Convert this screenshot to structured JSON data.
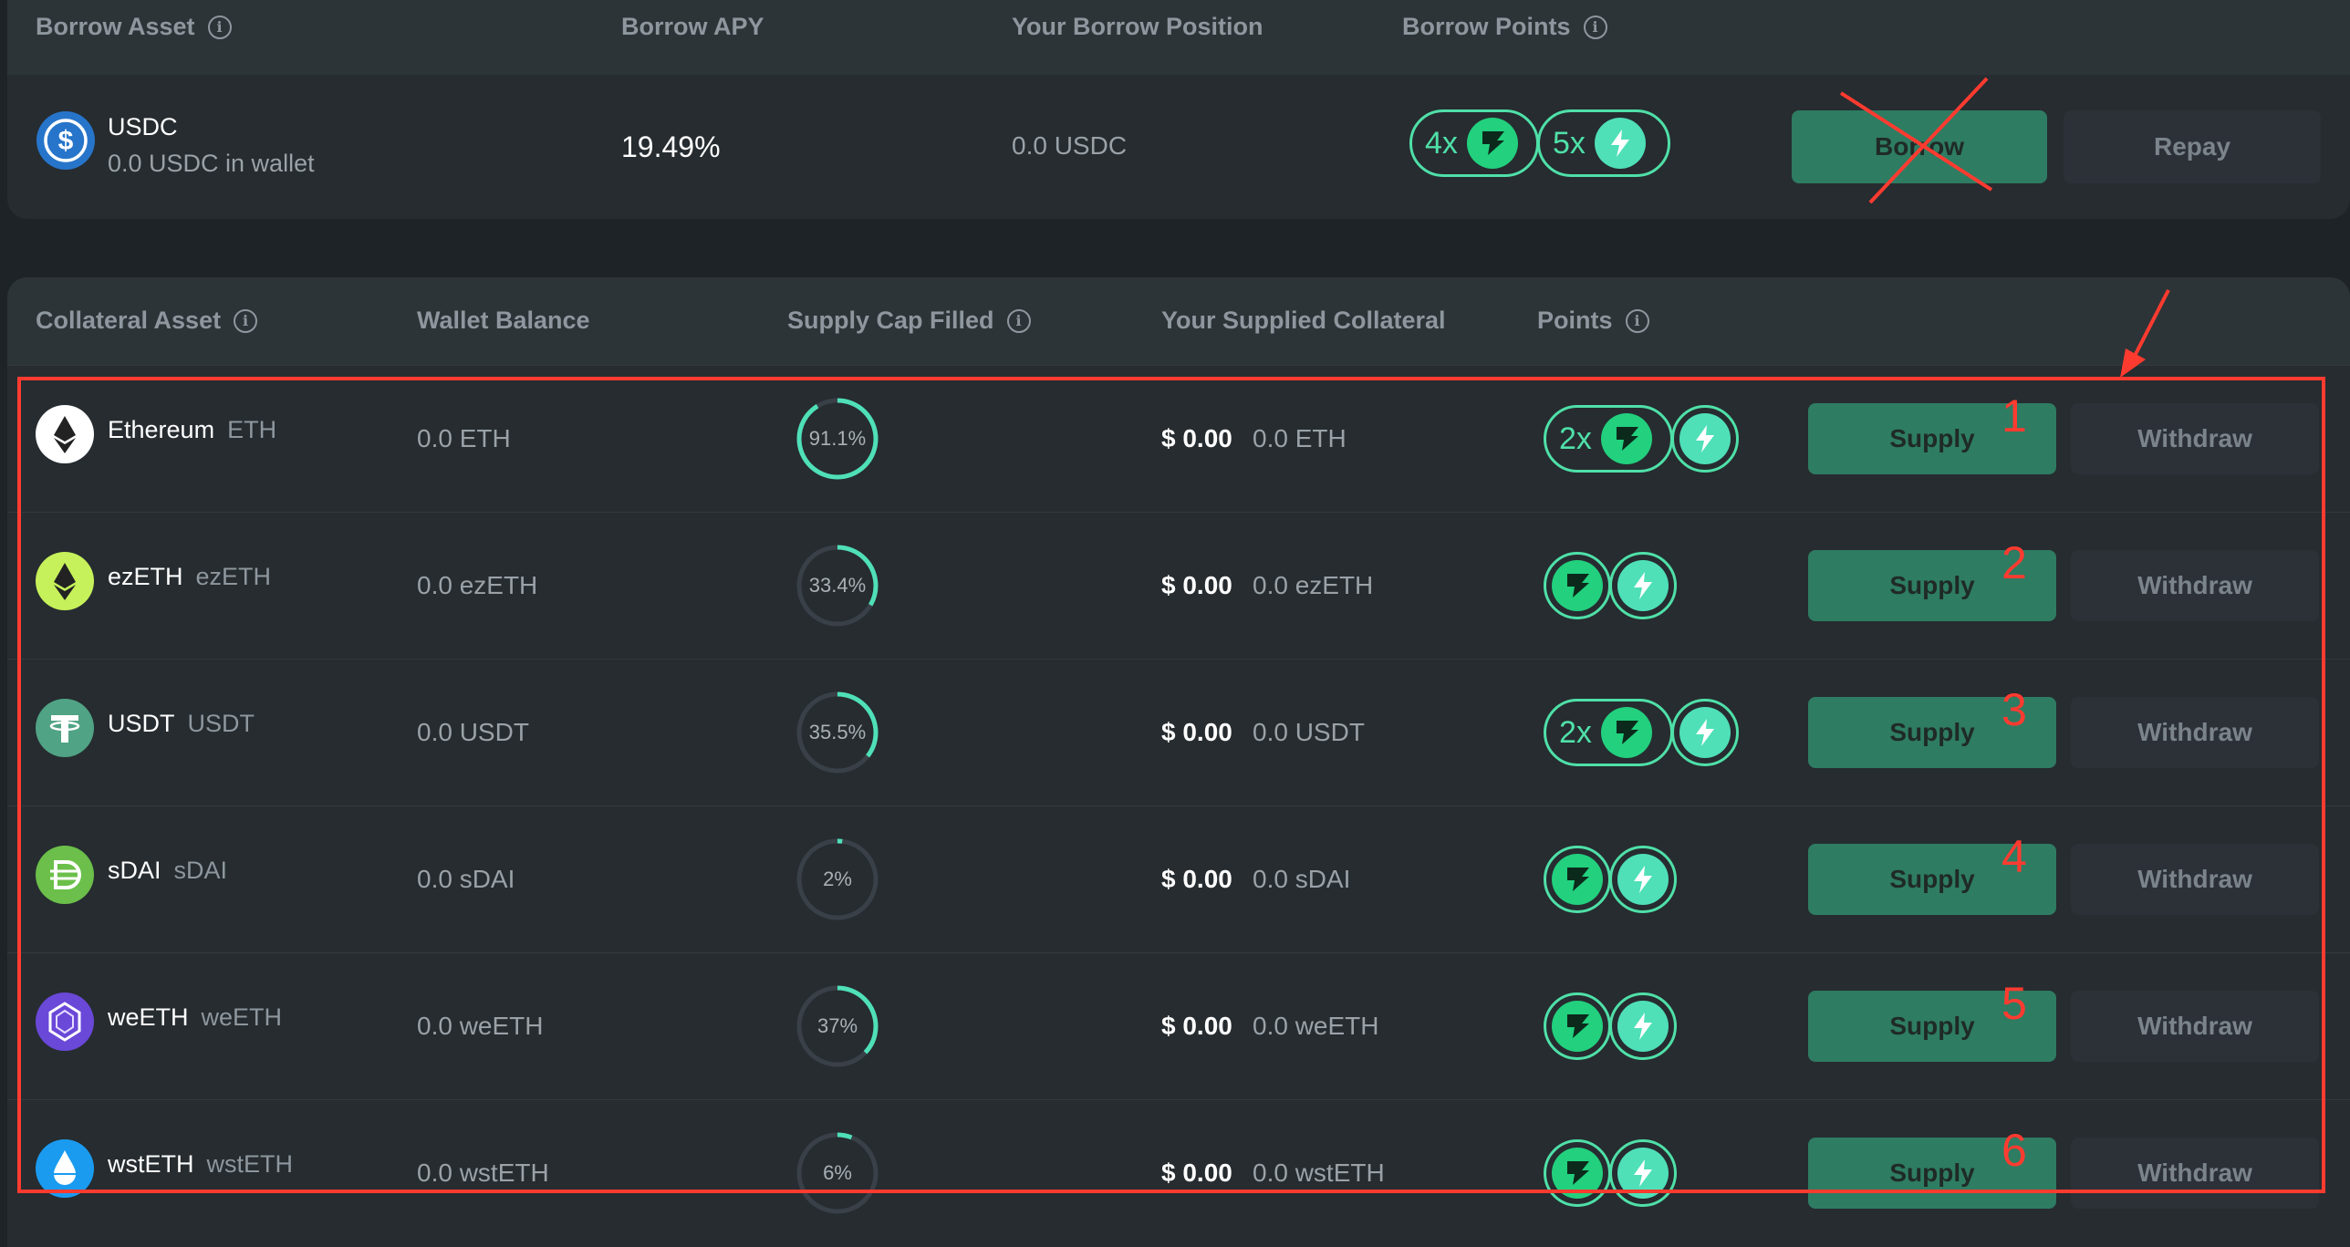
{
  "colors": {
    "accent": "#4fe0a8",
    "supply_button": "#2e7c62",
    "annotation_red": "#ff3b30"
  },
  "borrow": {
    "headers": [
      "Borrow Asset",
      "Borrow APY",
      "Your Borrow Position",
      "Borrow Points"
    ],
    "asset_name": "USDC",
    "wallet_text": "0.0 USDC in wallet",
    "apy": "19.49%",
    "position": "0.0 USDC",
    "points": [
      {
        "multiplier": "4x",
        "icon": "flag-icon"
      },
      {
        "multiplier": "5x",
        "icon": "lightning-icon"
      }
    ],
    "borrow_label": "Borrow",
    "repay_label": "Repay"
  },
  "collateral": {
    "headers": [
      "Collateral Asset",
      "Wallet Balance",
      "Supply Cap Filled",
      "Your Supplied Collateral",
      "Points"
    ],
    "rows": [
      {
        "name": "Ethereum",
        "symbol": "ETH",
        "balance": "0.0 ETH",
        "cap_label": "91.1%",
        "cap": 0.911,
        "usd": "$ 0.00",
        "amount": "0.0 ETH",
        "flag_mult": "2x",
        "supply": "Supply",
        "withdraw": "Withdraw",
        "annotation": "1"
      },
      {
        "name": "ezETH",
        "symbol": "ezETH",
        "balance": "0.0 ezETH",
        "cap_label": "33.4%",
        "cap": 0.334,
        "usd": "$ 0.00",
        "amount": "0.0 ezETH",
        "flag_mult": "",
        "supply": "Supply",
        "withdraw": "Withdraw",
        "annotation": "2"
      },
      {
        "name": "USDT",
        "symbol": "USDT",
        "balance": "0.0 USDT",
        "cap_label": "35.5%",
        "cap": 0.355,
        "usd": "$ 0.00",
        "amount": "0.0 USDT",
        "flag_mult": "2x",
        "supply": "Supply",
        "withdraw": "Withdraw",
        "annotation": "3"
      },
      {
        "name": "sDAI",
        "symbol": "sDAI",
        "balance": "0.0 sDAI",
        "cap_label": "2%",
        "cap": 0.02,
        "usd": "$ 0.00",
        "amount": "0.0 sDAI",
        "flag_mult": "",
        "supply": "Supply",
        "withdraw": "Withdraw",
        "annotation": "4"
      },
      {
        "name": "weETH",
        "symbol": "weETH",
        "balance": "0.0 weETH",
        "cap_label": "37%",
        "cap": 0.37,
        "usd": "$ 0.00",
        "amount": "0.0 weETH",
        "flag_mult": "",
        "supply": "Supply",
        "withdraw": "Withdraw",
        "annotation": "5"
      },
      {
        "name": "wstETH",
        "symbol": "wstETH",
        "balance": "0.0 wstETH",
        "cap_label": "6%",
        "cap": 0.06,
        "usd": "$ 0.00",
        "amount": "0.0 wstETH",
        "flag_mult": "",
        "supply": "Supply",
        "withdraw": "Withdraw",
        "annotation": "6"
      }
    ]
  }
}
